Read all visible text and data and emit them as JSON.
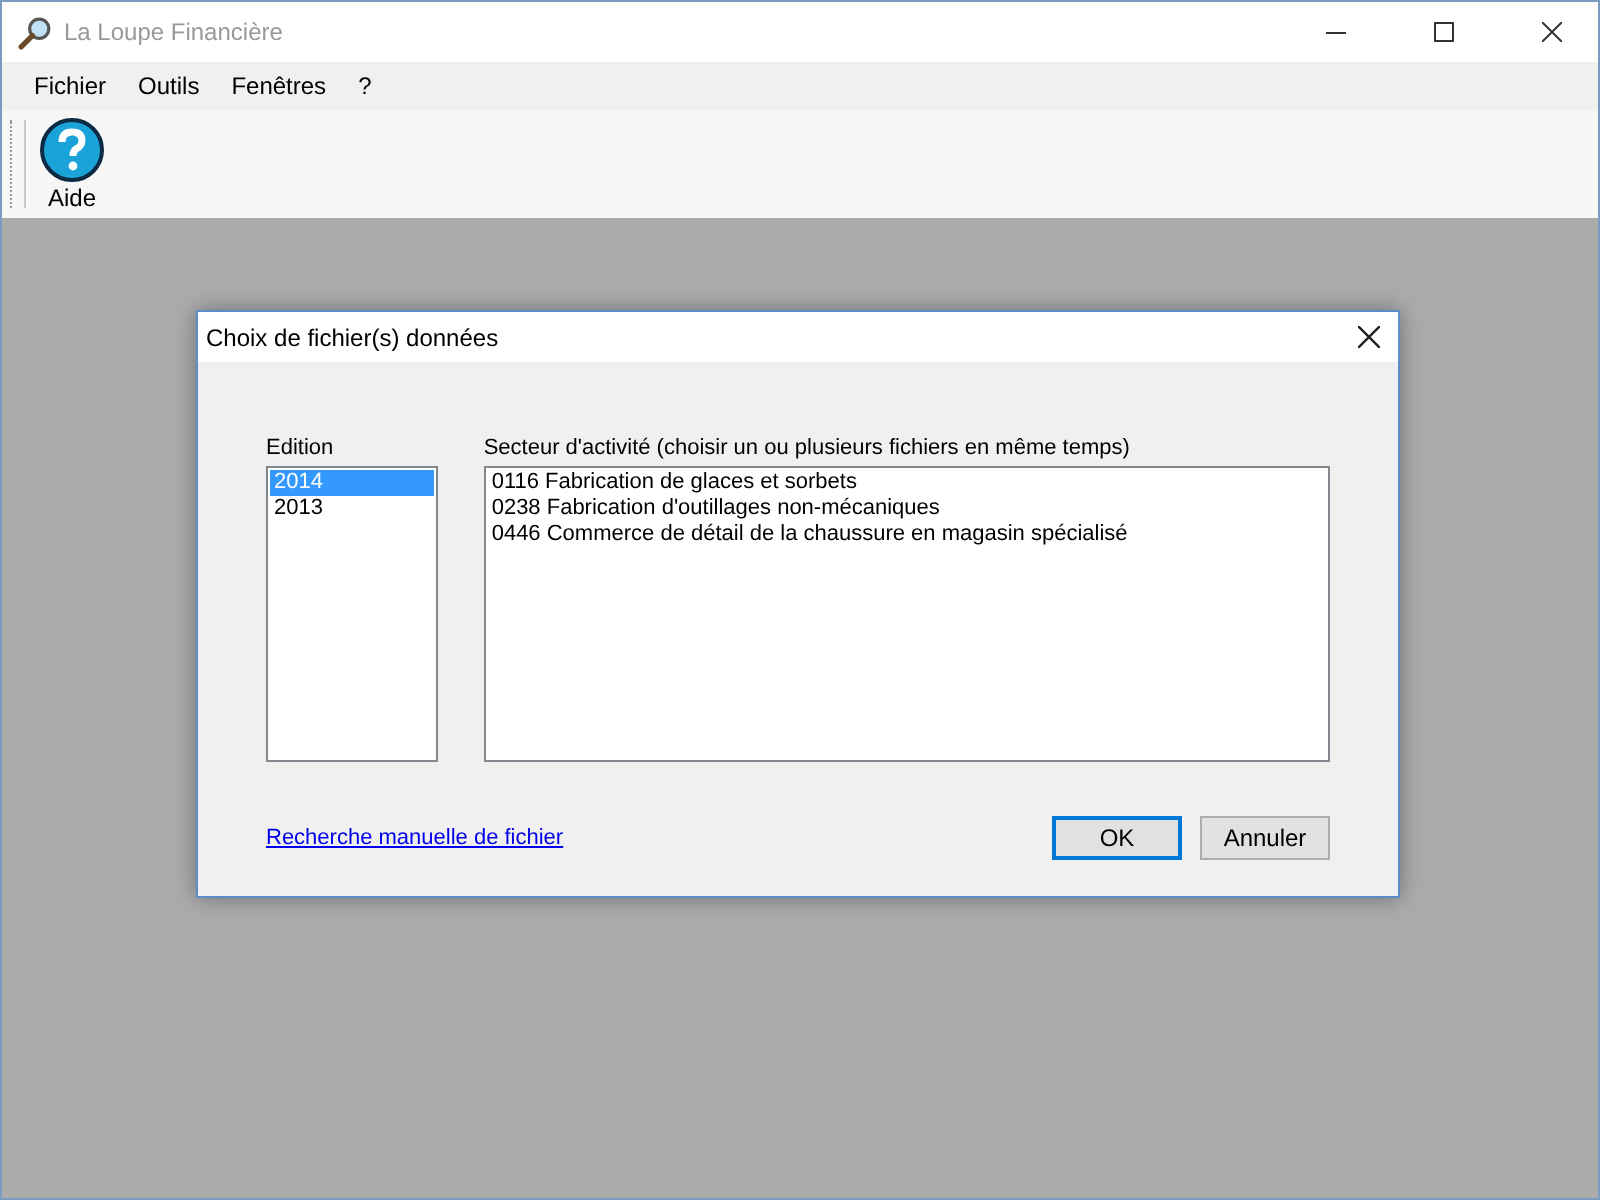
{
  "window": {
    "title": "La Loupe Financière"
  },
  "menu": [
    "Fichier",
    "Outils",
    "Fenêtres",
    "?"
  ],
  "toolbar": [
    {
      "label": "Aide",
      "kind": "help"
    }
  ],
  "dialog": {
    "title": "Choix de fichier(s) données",
    "edition": {
      "label": "Edition",
      "items": [
        {
          "text": "2014",
          "selected": true
        },
        {
          "text": "2013",
          "selected": false
        }
      ]
    },
    "sector": {
      "label": "Secteur d'activité (choisir un ou plusieurs fichiers en même temps)",
      "items": [
        {
          "text": "0116 Fabrication de glaces et sorbets",
          "selected": false
        },
        {
          "text": "0238 Fabrication d'outillages non-mécaniques",
          "selected": false
        },
        {
          "text": "0446 Commerce de détail de la chaussure en magasin spécialisé",
          "selected": false
        }
      ]
    },
    "link": "Recherche manuelle de fichier",
    "buttons": [
      {
        "label": "OK",
        "default": true
      },
      {
        "label": "Annuler",
        "default": false
      }
    ]
  }
}
